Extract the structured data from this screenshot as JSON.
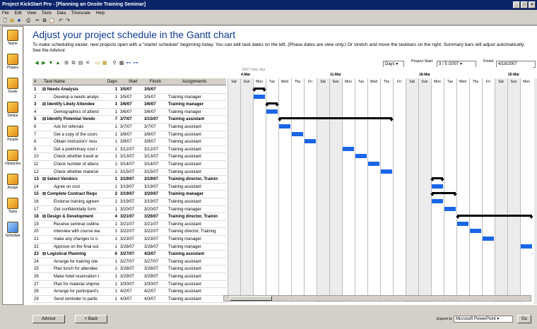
{
  "window": {
    "title": "Project KickStart Pro - [Planning an Onsite Training Seminar]"
  },
  "menu": [
    "File",
    "Edit",
    "View",
    "Tools",
    "Data",
    "Timescale",
    "Help"
  ],
  "sidebar": [
    {
      "label": "Name",
      "icon": "name-icon"
    },
    {
      "label": "Phases",
      "icon": "phases-icon"
    },
    {
      "label": "Goals",
      "icon": "goals-icon"
    },
    {
      "label": "Similar",
      "icon": "similar-icon"
    },
    {
      "label": "People",
      "icon": "people-icon"
    },
    {
      "label": "Obstacles",
      "icon": "obstacles-icon"
    },
    {
      "label": "Assign",
      "icon": "assign-icon"
    },
    {
      "label": "Tasks",
      "icon": "tasks-icon"
    },
    {
      "label": "Schedule",
      "icon": "schedule-icon"
    }
  ],
  "main": {
    "heading": "Adjust your project schedule in the Gantt chart",
    "description": "To make scheduling easier, new projects open with a \"starter schedule\" beginning today. You can edit task dates on the left. (Phase dates are view only.) Or stretch and move the taskbars on the right. Summary bars will adjust automatically. See the Advisor.",
    "scale_select": "Days",
    "project_start_label": "Project Start",
    "project_start": "3 / 5 /2007",
    "finish_label": "Finish",
    "finish": "4/18/2007"
  },
  "table": {
    "headers": {
      "num": "#",
      "name": "Task Name",
      "days": "Days",
      "start": "Start",
      "finish": "Finish",
      "assign": "Assignments"
    },
    "rows": [
      {
        "n": "1",
        "name": "⊟ Needs Analysis",
        "days": "1",
        "start": "3/5/07",
        "finish": "3/5/07",
        "assign": "",
        "s": 1
      },
      {
        "n": "2",
        "name": "Develop a needs analys",
        "days": "1",
        "start": "3/5/07",
        "finish": "3/5/07",
        "assign": "Training manager",
        "s": 0
      },
      {
        "n": "3",
        "name": "⊟ Identify Likely Attendee",
        "days": "1",
        "start": "3/6/07",
        "finish": "3/6/07",
        "assign": "Training manager",
        "s": 1
      },
      {
        "n": "4",
        "name": "Demographics of attend",
        "days": "1",
        "start": "3/6/07",
        "finish": "3/6/07",
        "assign": "Training manager",
        "s": 0
      },
      {
        "n": "5",
        "name": "⊟ Identify Potential Vendo",
        "days": "7",
        "start": "3/7/07",
        "finish": "3/15/07",
        "assign": "Training assistant",
        "s": 1
      },
      {
        "n": "6",
        "name": "Ask for referrals",
        "days": "1",
        "start": "3/7/07",
        "finish": "3/7/07",
        "assign": "Training assistant",
        "s": 0
      },
      {
        "n": "7",
        "name": "Get a copy of the cours",
        "days": "1",
        "start": "3/8/07",
        "finish": "3/8/07",
        "assign": "Training assistant",
        "s": 0
      },
      {
        "n": "8",
        "name": "Obtain instructors' resu",
        "days": "1",
        "start": "3/9/07",
        "finish": "3/9/07",
        "assign": "Training assistant",
        "s": 0
      },
      {
        "n": "9",
        "name": "Get a preliminary cost r",
        "days": "1",
        "start": "3/12/07",
        "finish": "3/12/07",
        "assign": "Training assistant",
        "s": 0
      },
      {
        "n": "10",
        "name": "Check whether travel ar",
        "days": "1",
        "start": "3/13/07",
        "finish": "3/13/07",
        "assign": "Training assistant",
        "s": 0
      },
      {
        "n": "11",
        "name": "Check number of attenc",
        "days": "1",
        "start": "3/14/07",
        "finish": "3/14/07",
        "assign": "Training assistant",
        "s": 0
      },
      {
        "n": "12",
        "name": "Check whether material",
        "days": "1",
        "start": "3/15/07",
        "finish": "3/15/07",
        "assign": "Training assistant",
        "s": 0
      },
      {
        "n": "13",
        "name": "⊟ Select Vendors",
        "days": "1",
        "start": "3/19/07",
        "finish": "3/19/07",
        "assign": "Training director, Trainin",
        "s": 1
      },
      {
        "n": "14",
        "name": "Agree on cost",
        "days": "1",
        "start": "3/19/07",
        "finish": "3/19/07",
        "assign": "Training assistant",
        "s": 0
      },
      {
        "n": "15",
        "name": "⊟ Complete Contract Requ",
        "days": "2",
        "start": "3/19/07",
        "finish": "3/20/07",
        "assign": "Training manager",
        "s": 1
      },
      {
        "n": "16",
        "name": "Endorse training agreen",
        "days": "1",
        "start": "3/19/07",
        "finish": "3/19/07",
        "assign": "Training assistant",
        "s": 0
      },
      {
        "n": "17",
        "name": "Get confidentially form :",
        "days": "1",
        "start": "3/20/07",
        "finish": "3/20/07",
        "assign": "Training manager",
        "s": 0
      },
      {
        "n": "18",
        "name": "⊟ Design & Development",
        "days": "4",
        "start": "3/21/07",
        "finish": "3/26/07",
        "assign": "Training director, Trainin",
        "s": 1
      },
      {
        "n": "19",
        "name": "Receive seminar outline",
        "days": "1",
        "start": "3/21/07",
        "finish": "3/21/07",
        "assign": "Training assistant",
        "s": 0
      },
      {
        "n": "20",
        "name": "interview with course lea",
        "days": "1",
        "start": "3/22/07",
        "finish": "3/22/07",
        "assign": "Training director, Training",
        "s": 0
      },
      {
        "n": "21",
        "name": "make any changes to o",
        "days": "1",
        "start": "3/23/07",
        "finish": "3/23/07",
        "assign": "Training manager",
        "s": 0
      },
      {
        "n": "22",
        "name": "Approve on the final out",
        "days": "1",
        "start": "3/26/07",
        "finish": "3/26/07",
        "assign": "Training manager",
        "s": 0
      },
      {
        "n": "23",
        "name": "⊟ Logistical Planning",
        "days": "6",
        "start": "3/27/07",
        "finish": "4/3/07",
        "assign": "Training assistant",
        "s": 1
      },
      {
        "n": "24",
        "name": "Arrange for training site",
        "days": "1",
        "start": "3/27/07",
        "finish": "3/27/07",
        "assign": "Training assistant",
        "s": 0
      },
      {
        "n": "25",
        "name": "Plan lunch for attendee:",
        "days": "1",
        "start": "3/28/07",
        "finish": "3/28/07",
        "assign": "Training assistant",
        "s": 0
      },
      {
        "n": "26",
        "name": "Make hotel reservation t",
        "days": "1",
        "start": "3/29/07",
        "finish": "3/29/07",
        "assign": "Training assistant",
        "s": 0
      },
      {
        "n": "27",
        "name": "Plan for material shipme",
        "days": "1",
        "start": "3/30/07",
        "finish": "3/30/07",
        "assign": "Training assistant",
        "s": 0
      },
      {
        "n": "28",
        "name": "Arrange for participant's",
        "days": "1",
        "start": "4/2/07",
        "finish": "4/2/07",
        "assign": "Training assistant",
        "s": 0
      },
      {
        "n": "29",
        "name": "Send reminder to partic",
        "days": "1",
        "start": "4/3/07",
        "finish": "4/3/07",
        "assign": "Training assistant",
        "s": 0
      }
    ]
  },
  "gantt": {
    "top_label": "2007-Mar-Apr",
    "weeks": [
      "4-Mar",
      "11-Mar",
      "18-Mar",
      "25-Mar"
    ],
    "days": [
      "Sat",
      "Sun",
      "Mon",
      "Tue",
      "Wed",
      "Thu",
      "Fri",
      "Sat",
      "Sun",
      "Mon",
      "Tue",
      "Wed",
      "Thu",
      "Fri",
      "Sat",
      "Sun",
      "Mon",
      "Tue",
      "Wed",
      "Thu",
      "Fri",
      "Sat",
      "Sun",
      "Mon"
    ]
  },
  "bottom": {
    "advisor": "Advisor",
    "back": "< Back",
    "export_label": "Export to",
    "export_value": "Microsoft PowerPoint",
    "go": "Go"
  }
}
